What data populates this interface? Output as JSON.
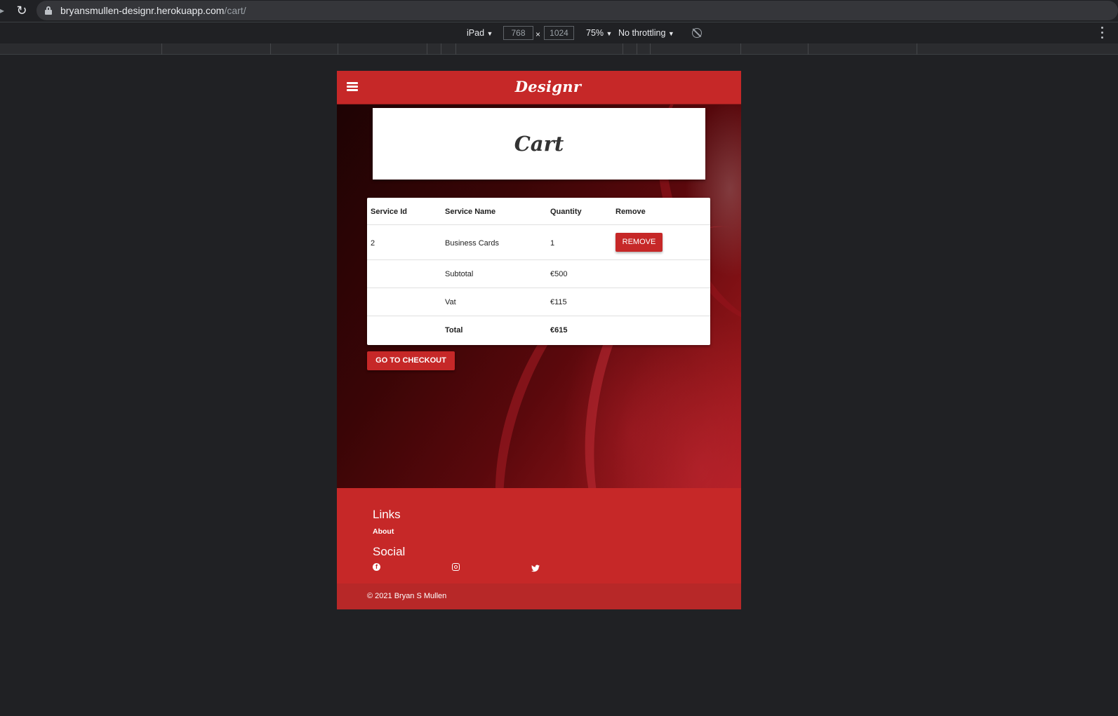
{
  "browser": {
    "url_host": "bryansmullen-designr.herokuapp.com",
    "url_path": "/cart/"
  },
  "devtools": {
    "device": "iPad",
    "width": "768",
    "height": "1024",
    "times_sign": "×",
    "zoom": "75%",
    "throttling": "No throttling",
    "dropdown_glyph": "▼"
  },
  "site": {
    "brand": "Designr",
    "page_title": "Cart",
    "table": {
      "headers": [
        "Service Id",
        "Service Name",
        "Quantity",
        "Remove"
      ],
      "items": [
        {
          "service_id": "2",
          "service_name": "Business Cards",
          "quantity": "1",
          "remove_label": "REMOVE"
        }
      ],
      "subtotal_label": "Subtotal",
      "subtotal_value": "€500",
      "vat_label": "Vat",
      "vat_value": "€115",
      "total_label": "Total",
      "total_value": "€615"
    },
    "checkout_label": "GO TO CHECKOUT",
    "footer": {
      "links_heading": "Links",
      "about_link": "About",
      "social_heading": "Social",
      "social_icons": [
        "facebook-icon",
        "instagram-icon",
        "twitter-icon"
      ],
      "copyright": "© 2021 Bryan S Mullen"
    },
    "colors": {
      "brand_red": "#c62828",
      "footer_bottom": "#b72828",
      "page_bg": "#202124"
    }
  }
}
